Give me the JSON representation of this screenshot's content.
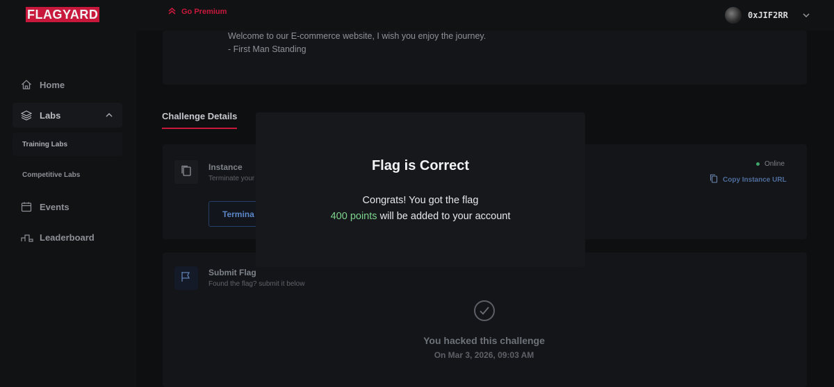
{
  "brand": {
    "logo": "FLAGYARD",
    "accent_color": "#c8193d"
  },
  "header": {
    "premium_label": "Go Premium",
    "username": "0xJIF2RR"
  },
  "sidebar": {
    "items": [
      {
        "label": "Home",
        "icon": "home-icon"
      },
      {
        "label": "Labs",
        "icon": "layers-icon"
      },
      {
        "label": "Events",
        "icon": "calendar-icon"
      },
      {
        "label": "Leaderboard",
        "icon": "podium-icon"
      }
    ],
    "sub_items": [
      {
        "label": "Training Labs"
      },
      {
        "label": "Competitive Labs"
      }
    ]
  },
  "description": {
    "line1": "Welcome to our E-commerce website, I wish you enjoy the journey.",
    "line2": "- First Man Standing"
  },
  "tabs": {
    "active": "Challenge Details"
  },
  "instance": {
    "title": "Instance",
    "subtitle": "Terminate your",
    "terminate_label": "Termina",
    "status": "Online",
    "status_color": "#3ea66a",
    "copy_label": "Copy Instance URL"
  },
  "submit_flag": {
    "title": "Submit Flag",
    "subtitle": "Found the flag? submit it below",
    "hacked_text": "You hacked this challenge",
    "hacked_date": "On Mar 3, 2026, 09:03 AM"
  },
  "modal": {
    "title": "Flag is Correct",
    "line1": "Congrats! You got the flag",
    "points": "400 points",
    "line2_rest": "will be added to your account",
    "points_color": "#7ed38f"
  }
}
